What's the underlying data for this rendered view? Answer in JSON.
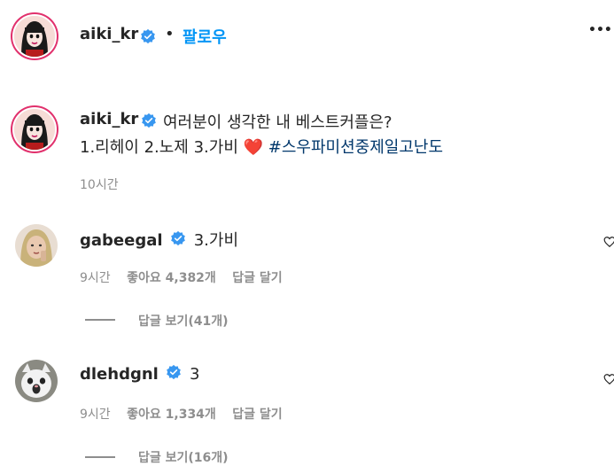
{
  "header": {
    "username": "aiki_kr",
    "separator": "•",
    "follow_label": "팔로우",
    "more": "•••"
  },
  "caption": {
    "username": "aiki_kr",
    "text_line1": "여러분이 생각한 내 베스트커플은?",
    "text_line2": "1.리헤이 2.노제 3.가비 ",
    "heart_emoji": "❤️",
    "hashtag": "#스우파미션중제일고난도",
    "time": "10시간"
  },
  "comments": [
    {
      "username": "gabeegal",
      "text": "3.가비",
      "time": "9시간",
      "likes_label": "좋아요 4,382개",
      "reply_label": "답글 달기",
      "view_replies": "답글 보기(41개)"
    },
    {
      "username": "dlehdgnl",
      "text": "3",
      "time": "9시간",
      "likes_label": "좋아요 1,334개",
      "reply_label": "답글 달기",
      "view_replies": "답글 보기(16개)"
    }
  ],
  "colors": {
    "accent": "#0095f6",
    "verified": "#3897f0",
    "hashtag": "#00376b",
    "muted": "#8e8e8e"
  }
}
